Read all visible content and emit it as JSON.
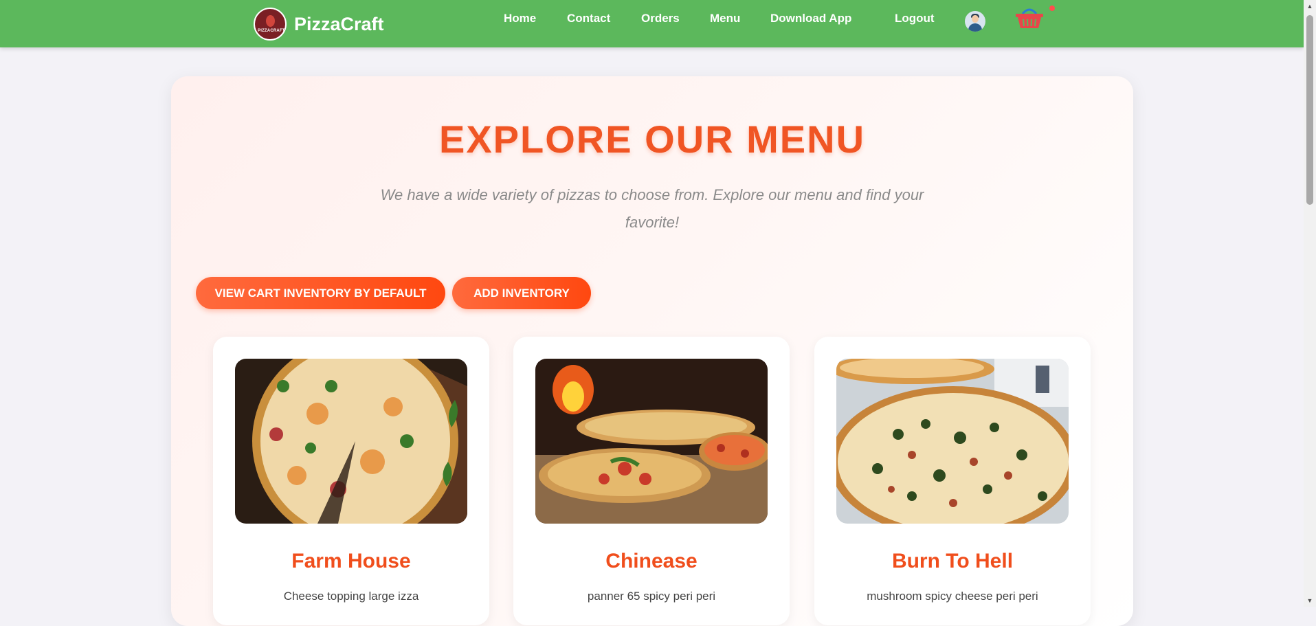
{
  "navbar": {
    "brand": "PizzaCraft",
    "logo_text": "PIZZACRAFT",
    "links": [
      "Home",
      "Contact",
      "Orders",
      "Menu",
      "Download App",
      "Logout"
    ],
    "background": "#5cb85c"
  },
  "hero": {
    "title": "EXPLORE OUR MENU",
    "subtitle": "We have a wide variety of pizzas to choose from. Explore our menu and find your favorite!"
  },
  "actions": {
    "view_cart": "VIEW CART INVENTORY BY DEFAULT",
    "add_inventory": "ADD INVENTORY"
  },
  "menu_items": [
    {
      "name": "Farm House",
      "description": "Cheese topping large izza"
    },
    {
      "name": "Chinease",
      "description": "panner 65 spicy peri peri"
    },
    {
      "name": "Burn To Hell",
      "description": "mushroom spicy cheese peri peri"
    }
  ],
  "colors": {
    "accent": "#f05524",
    "button_gradient_start": "#ff6a3d",
    "button_gradient_end": "#ff4810",
    "cart_badge": "#ff4d4d"
  },
  "icons": [
    "user-avatar-icon",
    "shopping-basket-icon",
    "scroll-up-arrow-icon",
    "scroll-down-arrow-icon"
  ]
}
